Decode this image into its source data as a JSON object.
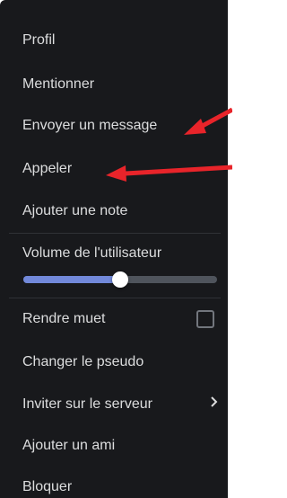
{
  "menu": {
    "items": [
      {
        "label": "Profil"
      },
      {
        "label": "Mentionner"
      },
      {
        "label": "Envoyer un message"
      },
      {
        "label": "Appeler"
      },
      {
        "label": "Ajouter une note"
      },
      {
        "label": "Volume de l'utilisateur"
      },
      {
        "label": "Rendre muet"
      },
      {
        "label": "Changer le pseudo"
      },
      {
        "label": "Inviter sur le serveur"
      },
      {
        "label": "Ajouter un ami"
      },
      {
        "label": "Bloquer"
      }
    ],
    "volume_level": 0.5,
    "mute_checked": false,
    "submenu_icon": "chevron-right-icon"
  },
  "colors": {
    "background": "#18191c",
    "text": "#dcddde",
    "slider_fill": "#7289da",
    "annotation_arrow": "#e8242a"
  },
  "annotations": {
    "arrow_icon": "red-arrow-icon"
  }
}
